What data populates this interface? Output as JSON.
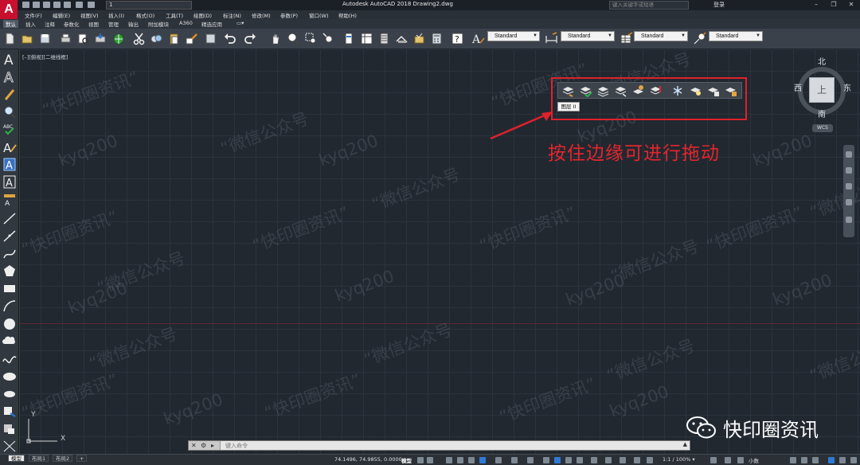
{
  "titlebar": {
    "app_logo": "A",
    "workspace": "1",
    "title": "Autodesk AutoCAD 2018    Drawing2.dwg",
    "search_placeholder": "键入关键字或短语",
    "login": "登录",
    "minimize": "–",
    "maximize": "❐",
    "close": "✕"
  },
  "menu": [
    "文件(F)",
    "编辑(E)",
    "视图(V)",
    "插入(I)",
    "格式(O)",
    "工具(T)",
    "绘图(D)",
    "标注(N)",
    "修改(M)",
    "参数(P)",
    "窗口(W)",
    "帮助(H)"
  ],
  "tabs": [
    "默认",
    "插入",
    "注释",
    "参数化",
    "视图",
    "管理",
    "输出",
    "附加模块",
    "A360",
    "精选应用"
  ],
  "toolbar": {
    "text_style": "Standard",
    "dim_style": "Standard",
    "table_style": "Standard",
    "multileader_style": "Standard"
  },
  "viewport_label": "[–][俯视][二维线框]",
  "layers_toolbar": {
    "tooltip": "图层 II"
  },
  "annotation_text": "按住边缘可进行拖动",
  "viewcube": {
    "face": "上",
    "north": "北",
    "south": "南",
    "east": "东",
    "west": "西",
    "wcs": "WCS"
  },
  "ucs": {
    "y": "Y",
    "x": "X"
  },
  "watermarks": {
    "handle": "kyq200",
    "wechat": "“微信公众号",
    "news": "“快印圈资讯”"
  },
  "brand": {
    "name": "快印圈资讯"
  },
  "command_line": {
    "placeholder": "键入命令",
    "close_icon": "✕",
    "wrench_icon": "🔧"
  },
  "layout_tabs": [
    "模型",
    "布局1",
    "布局2",
    "+"
  ],
  "statusbar": {
    "coords": "74.1496, 74.9855, 0.0000",
    "model": "模型",
    "scale": "1:1 / 100% ▾",
    "units": "小数"
  },
  "colors": {
    "accent_red": "#e5252d",
    "canvas_bg": "#212830"
  }
}
